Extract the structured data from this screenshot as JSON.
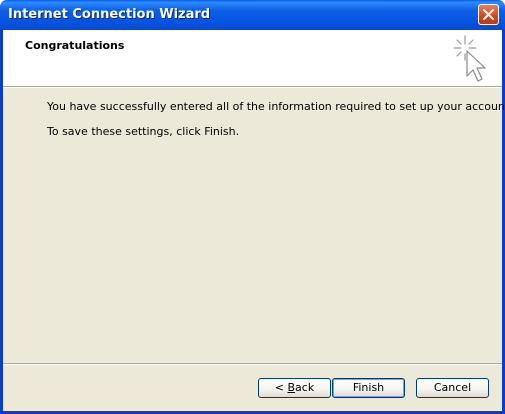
{
  "window": {
    "title": "Internet Connection Wizard"
  },
  "header": {
    "title": "Congratulations",
    "icon": "wizard-sparkle-cursor-icon"
  },
  "content": {
    "line1": "You have successfully entered all of the information required to set up your account.",
    "line2": "To save these settings, click Finish."
  },
  "buttons": {
    "back_prefix": "< ",
    "back_mnemonic": "B",
    "back_rest": "ack",
    "finish": "Finish",
    "cancel": "Cancel"
  },
  "colors": {
    "titlebar": "#0553e0",
    "close": "#d2461f",
    "dialog_bg": "#ece9d8",
    "button_border": "#003c74"
  }
}
